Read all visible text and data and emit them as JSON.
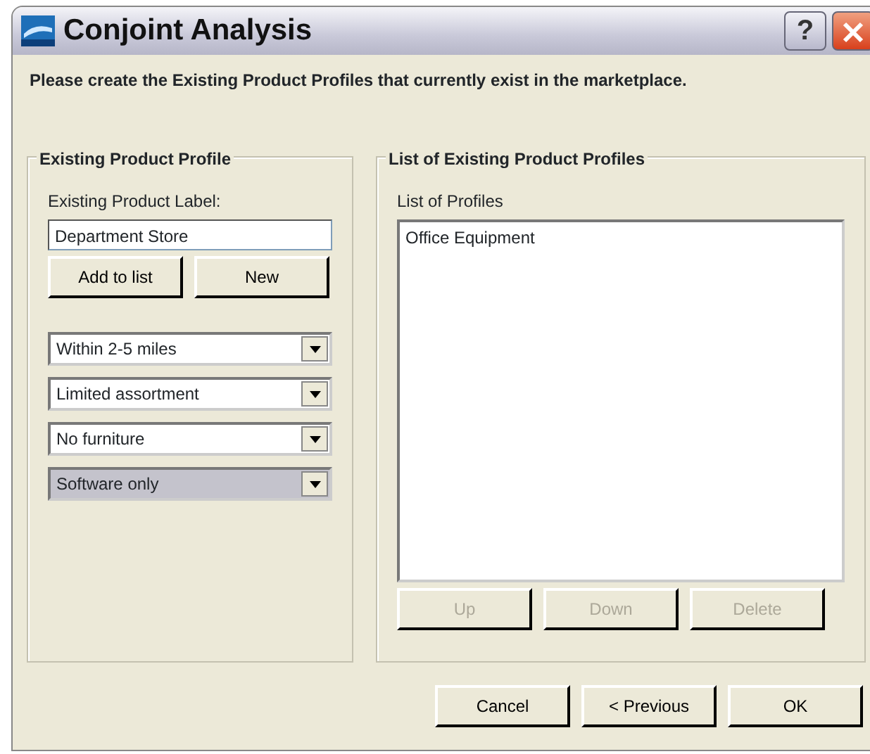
{
  "window": {
    "title": "Conjoint Analysis",
    "buttons": [
      {
        "kind": "help",
        "label": "?"
      },
      {
        "kind": "close"
      }
    ]
  },
  "instruction": "Please create the Existing Product Profiles that currently exist in the marketplace.",
  "profile_group": {
    "title": "Existing Product Profile",
    "field_label": "Existing Product Label:",
    "field_value": "Department Store",
    "buttons": [
      {
        "label": "Add to list",
        "disabled": false
      },
      {
        "label": "New",
        "disabled": false
      }
    ],
    "dropdowns": [
      {
        "value": "Within 2-5 miles",
        "selected": false
      },
      {
        "value": "Limited assortment",
        "selected": false
      },
      {
        "value": "No furniture",
        "selected": false
      },
      {
        "value": "Software only",
        "selected": true
      }
    ]
  },
  "list_group": {
    "title": "List of Existing Product Profiles",
    "list_label": "List of Profiles",
    "items": [
      "Office Equipment"
    ],
    "buttons": [
      {
        "label": "Up",
        "disabled": true
      },
      {
        "label": "Down",
        "disabled": true
      },
      {
        "label": "Delete",
        "disabled": true
      }
    ]
  },
  "footer_buttons": [
    {
      "label": "Cancel",
      "disabled": false
    },
    {
      "label": "< Previous",
      "disabled": false
    },
    {
      "label": "OK",
      "disabled": false
    }
  ]
}
